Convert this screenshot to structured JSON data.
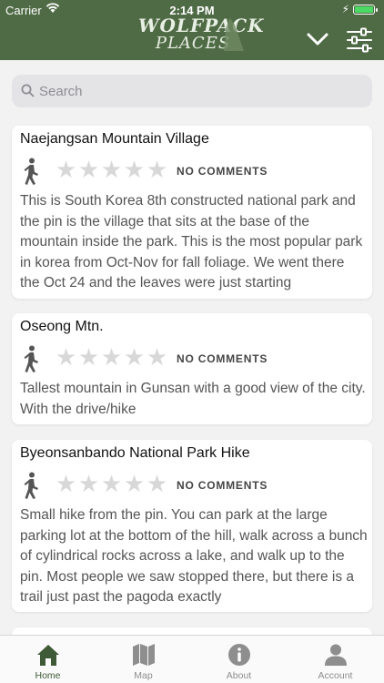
{
  "status_bar": {
    "carrier": "Carrier",
    "time": "2:14 PM"
  },
  "header": {
    "logo_line1": "WOLFPACK",
    "logo_line2": "PLACES",
    "brand_color": "#4f6b45",
    "chevron_icon": "chevron-down-icon",
    "filter_icon": "sliders-icon"
  },
  "search": {
    "placeholder": "Search",
    "value": ""
  },
  "places": [
    {
      "title": "Naejangsan Mountain Village",
      "rating": 0,
      "max_rating": 5,
      "comments": "NO COMMENTS",
      "description": "This is South Korea 8th constructed national park and the pin is the village that sits at the base of the mountain inside the park. This is the most popular park in korea from Oct-Nov for fall foliage. We went there the Oct 24 and the leaves were just starting"
    },
    {
      "title": "Oseong Mtn.",
      "rating": 0,
      "max_rating": 5,
      "comments": "NO COMMENTS",
      "description": "Tallest mountain in Gunsan with a good view of the city. With the drive/hike"
    },
    {
      "title": "Byeonsanbando National Park Hike",
      "rating": 0,
      "max_rating": 5,
      "comments": "NO COMMENTS",
      "description": "Small hike from the pin. You can park at the large parking lot at the bottom of the hill, walk across a bunch of cylindrical rocks across a lake, and walk up to the pin. Most people we saw stopped there, but there is a trail just past the pagoda exactly"
    }
  ],
  "tabs": [
    {
      "label": "Home",
      "icon": "home-icon",
      "active": true
    },
    {
      "label": "Map",
      "icon": "map-icon",
      "active": false
    },
    {
      "label": "About",
      "icon": "info-icon",
      "active": false
    },
    {
      "label": "Account",
      "icon": "account-icon",
      "active": false
    }
  ],
  "colors": {
    "active_tab": "#3f5a36",
    "inactive_tab": "#8e8e8e",
    "star_empty": "#d8d8d8"
  }
}
